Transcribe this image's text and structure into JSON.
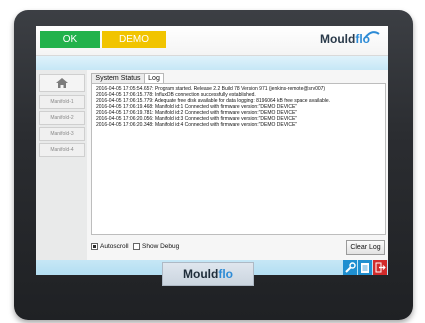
{
  "topbar": {
    "ok_label": "OK",
    "demo_label": "DEMO",
    "brand_main": "Mould",
    "brand_accent": "flo"
  },
  "sidebar": {
    "items": [
      {
        "label": "Manifold-1"
      },
      {
        "label": "Manifold-2"
      },
      {
        "label": "Manifold-3"
      },
      {
        "label": "Manifold-4"
      }
    ]
  },
  "tabs": [
    {
      "label": "System Status",
      "active": false
    },
    {
      "label": "Log",
      "active": true
    }
  ],
  "log": {
    "lines": [
      "2016-04-05 17:05:54.657: Program started. Release 2.2 Build 78 Version 971 (jenkins-remote@srv007)",
      "2016-04-05 17:06:15.778: InfluxDB connection successfully established.",
      "2016-04-05 17:06:15.779: Adequate free disk available for data logging: 8196064 kB free space available.",
      "2016-04-05 17:06:19.468: Manifold id:1 Connected with firmware version:\"DEMO DEVICE\"",
      "2016-04-05 17:06:19.781: Manifold id:2 Connected with firmware version:\"DEMO DEVICE\"",
      "2016-04-05 17:06:20.056: Manifold id:3 Connected with firmware version:\"DEMO DEVICE\"",
      "2016-04-05 17:06:20.348: Manifold id:4 Connected with firmware version:\"DEMO DEVICE\""
    ]
  },
  "controls": {
    "autoscroll_label": "Autoscroll",
    "autoscroll_checked": true,
    "showdebug_label": "Show Debug",
    "showdebug_checked": false,
    "clear_label": "Clear Log"
  },
  "footer": {
    "icons": [
      "wrench-icon",
      "notepad-icon",
      "exit-icon"
    ]
  },
  "bezel": {
    "brand_main": "Mould",
    "brand_accent": "flo"
  },
  "colors": {
    "ok": "#22b24c",
    "demo": "#f1c400",
    "accent": "#2d8bd6",
    "footer_icon": "#1f8fd0",
    "exit_icon": "#d12b2b"
  }
}
